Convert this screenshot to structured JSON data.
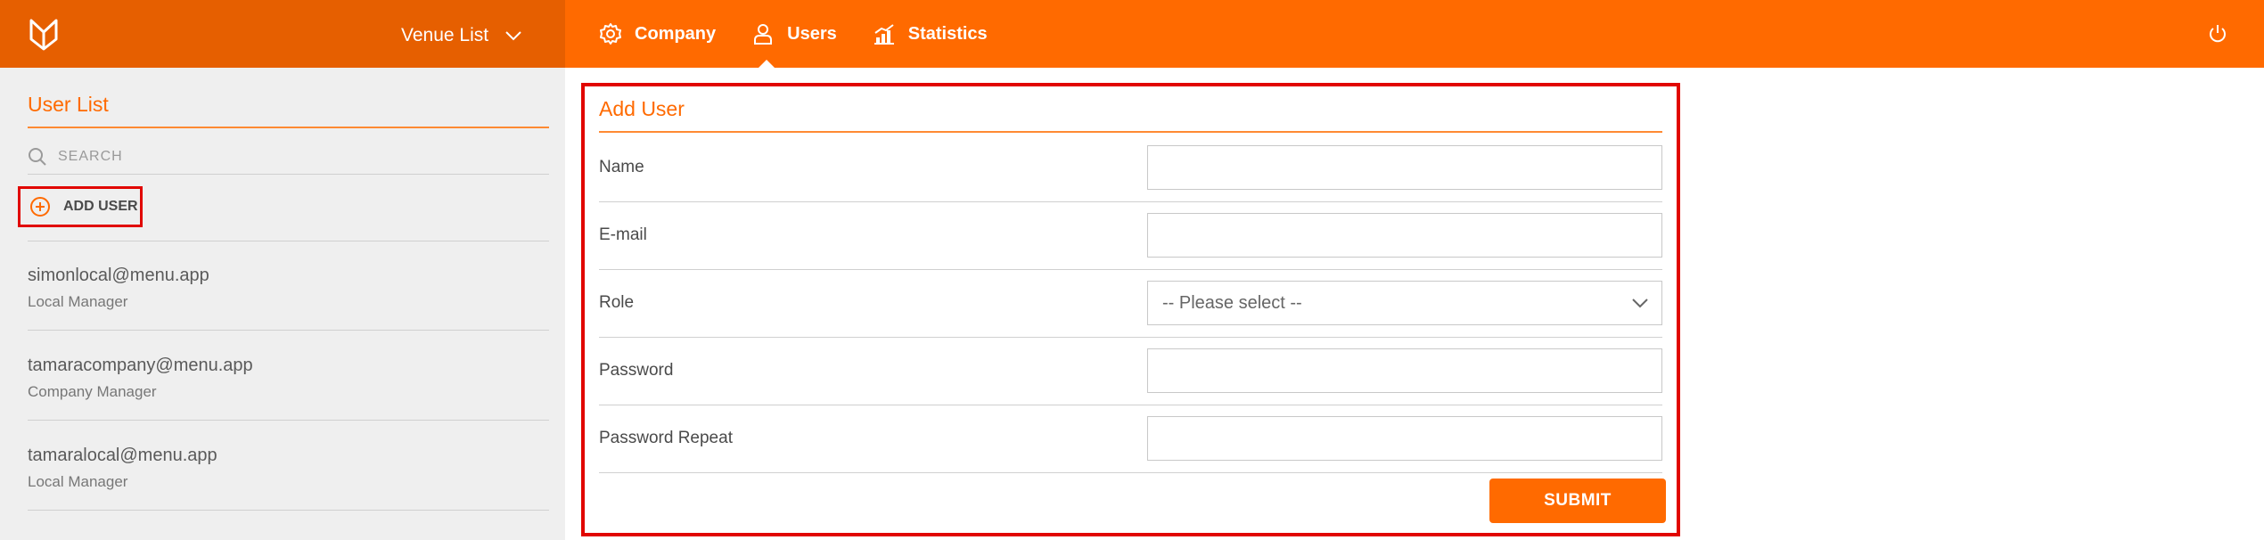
{
  "header": {
    "logo_icon": "menu-logo-icon",
    "venue_selector": "Venue List",
    "nav": [
      {
        "label": "Company",
        "icon": "gear-icon"
      },
      {
        "label": "Users",
        "icon": "user-icon",
        "active": true
      },
      {
        "label": "Statistics",
        "icon": "chart-icon"
      }
    ],
    "power_icon": "power-icon"
  },
  "sidebar": {
    "title": "User List",
    "search_placeholder": "SEARCH",
    "add_user_label": "ADD USER",
    "users": [
      {
        "email": "simonlocal@menu.app",
        "role": "Local Manager"
      },
      {
        "email": "tamaracompany@menu.app",
        "role": "Company Manager"
      },
      {
        "email": "tamaralocal@menu.app",
        "role": "Local Manager"
      }
    ]
  },
  "form": {
    "title": "Add User",
    "fields": {
      "name": {
        "label": "Name",
        "value": ""
      },
      "email": {
        "label": "E-mail",
        "value": ""
      },
      "role": {
        "label": "Role",
        "selected": "-- Please select --"
      },
      "password": {
        "label": "Password",
        "value": ""
      },
      "password_repeat": {
        "label": "Password Repeat",
        "value": ""
      }
    },
    "submit_label": "SUBMIT"
  },
  "colors": {
    "brand": "#ff6a00",
    "brand_dark": "#e65f00",
    "highlight": "#e10600",
    "sidebar_bg": "#efefef"
  }
}
